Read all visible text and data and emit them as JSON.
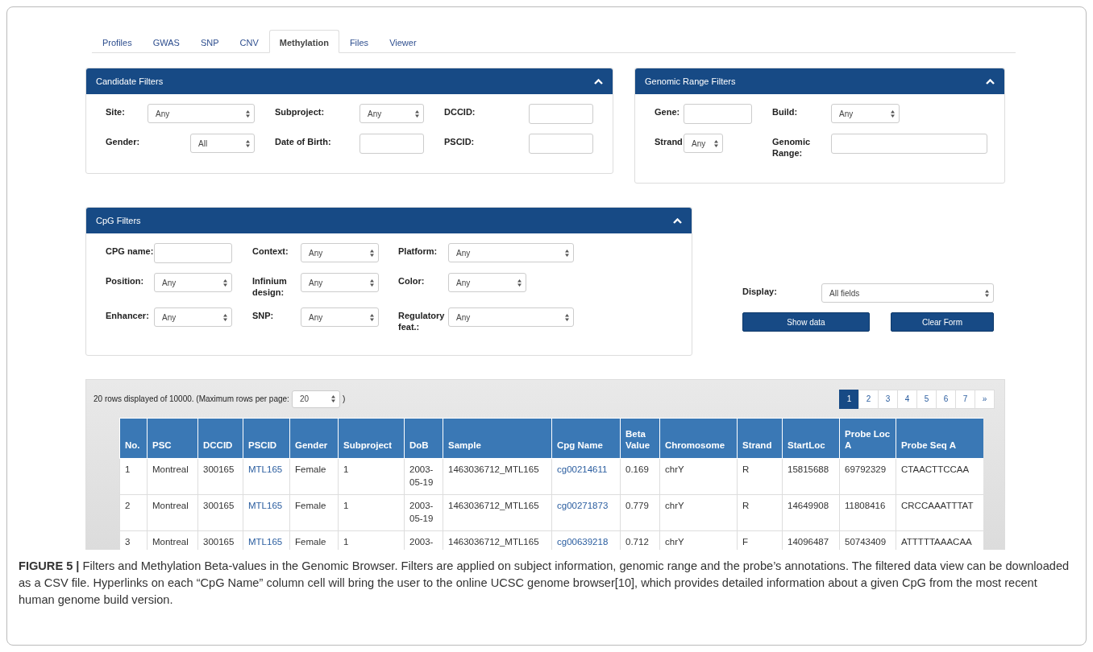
{
  "tabs": [
    {
      "label": "Profiles",
      "selected": false
    },
    {
      "label": "GWAS",
      "selected": false
    },
    {
      "label": "SNP",
      "selected": false
    },
    {
      "label": "CNV",
      "selected": false
    },
    {
      "label": "Methylation",
      "selected": true
    },
    {
      "label": "Files",
      "selected": false
    },
    {
      "label": "Viewer",
      "selected": false
    }
  ],
  "candidate_filters": {
    "title": "Candidate Filters",
    "expanded": true,
    "fields": [
      {
        "label": "Site:",
        "kind": "select",
        "value": "Any"
      },
      {
        "label": "Subproject:",
        "kind": "select",
        "value": "Any"
      },
      {
        "label": "DCCID:",
        "kind": "text"
      },
      {
        "label": "Gender:",
        "kind": "select",
        "value": "All"
      },
      {
        "label": "Date of Birth:",
        "kind": "text"
      },
      {
        "label": "PSCID:",
        "kind": "text"
      }
    ]
  },
  "genomic_range_filters": {
    "title": "Genomic Range Filters",
    "expanded": true,
    "fields": [
      {
        "label": "Gene:",
        "kind": "text"
      },
      {
        "label": "Build:",
        "kind": "select",
        "value": "Any"
      },
      {
        "label": "Strand",
        "kind": "select",
        "value": "Any"
      },
      {
        "label": "Genomic Range:",
        "kind": "text"
      }
    ]
  },
  "cpg_filters": {
    "title": "CpG Filters",
    "expanded": true,
    "fields": [
      {
        "label": "CPG name:",
        "kind": "text"
      },
      {
        "label": "Context:",
        "kind": "select",
        "value": "Any"
      },
      {
        "label": "Platform:",
        "kind": "select",
        "value": "Any"
      },
      {
        "label": "Position:",
        "kind": "select",
        "value": "Any"
      },
      {
        "label": "Infinium design:",
        "kind": "select",
        "value": "Any"
      },
      {
        "label": "Color:",
        "kind": "select",
        "value": "Any"
      },
      {
        "label": "Enhancer:",
        "kind": "select",
        "value": "Any"
      },
      {
        "label": "SNP:",
        "kind": "select",
        "value": "Any"
      },
      {
        "label": "Regulatory feat.:",
        "kind": "select",
        "value": "Any"
      }
    ]
  },
  "display": {
    "label": "Display:",
    "value": "All fields"
  },
  "buttons": [
    "Show data",
    "Clear Form"
  ],
  "results": {
    "info": "20 rows displayed of 10000. (Maximum rows per page:",
    "page_size": "20",
    "info_end": ")",
    "pages": [
      {
        "label": "1",
        "selected": true
      },
      {
        "label": "2",
        "selected": false
      },
      {
        "label": "3",
        "selected": false
      },
      {
        "label": "4",
        "selected": false
      },
      {
        "label": "5",
        "selected": false
      },
      {
        "label": "6",
        "selected": false
      },
      {
        "label": "7",
        "selected": false
      },
      {
        "label": "»",
        "selected": false
      }
    ],
    "columns": [
      {
        "label": "No.",
        "link": false
      },
      {
        "label": "PSC",
        "link": false
      },
      {
        "label": "DCCID",
        "link": false
      },
      {
        "label": "PSCID",
        "link": true
      },
      {
        "label": "Gender",
        "link": false
      },
      {
        "label": "Subproject",
        "link": false
      },
      {
        "label": "DoB",
        "link": false
      },
      {
        "label": "Sample",
        "link": false
      },
      {
        "label": "Cpg Name",
        "link": true
      },
      {
        "label": "Beta Value",
        "link": false
      },
      {
        "label": "Chromosome",
        "link": false
      },
      {
        "label": "Strand",
        "link": false
      },
      {
        "label": "StartLoc",
        "link": false
      },
      {
        "label": "Probe Loc A",
        "link": false
      },
      {
        "label": "Probe Seq A",
        "link": false
      }
    ],
    "rows": [
      [
        "1",
        "Montreal",
        "300165",
        "MTL165",
        "Female",
        "1",
        "2003-05-19",
        "1463036712_MTL165",
        "cg00214611",
        "0.169",
        "chrY",
        "R",
        "15815688",
        "69792329",
        "CTAACTTCCAA"
      ],
      [
        "2",
        "Montreal",
        "300165",
        "MTL165",
        "Female",
        "1",
        "2003-05-19",
        "1463036712_MTL165",
        "cg00271873",
        "0.779",
        "chrY",
        "R",
        "14649908",
        "11808416",
        "CRCCAAATTTAT"
      ],
      [
        "3",
        "Montreal",
        "300165",
        "MTL165",
        "Female",
        "1",
        "2003-",
        "1463036712_MTL165",
        "cg00639218",
        "0.712",
        "chrY",
        "F",
        "14096487",
        "50743409",
        "ATTTTTAAACAA"
      ]
    ]
  },
  "caption": "**FIGURE 5 |** Filters and Methylation Beta-values in the Genomic Browser. Filters are applied on subject information, genomic range and the probe’s annotations. The filtered data view can be downloaded as a CSV file. Hyperlinks on each “CpG Name” column cell will bring the user to the online UCSC genome browser[10], which provides detailed information about a given CpG from the most recent human genome build version."
}
